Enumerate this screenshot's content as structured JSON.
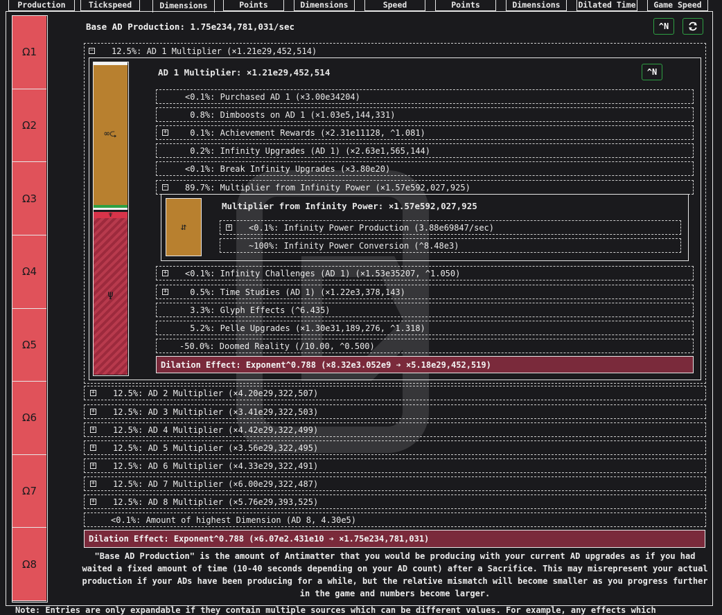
{
  "tabs": [
    {
      "label": "Production"
    },
    {
      "label": "Tickspeed"
    },
    {
      "label": "Dimensions",
      "active": true
    },
    {
      "label": "Points"
    },
    {
      "label": "Dimensions"
    },
    {
      "label": "Speed"
    },
    {
      "label": "Points"
    },
    {
      "label": "Dimensions"
    },
    {
      "label": "Dilated Time"
    },
    {
      "label": "Game Speed"
    }
  ],
  "sidebar": {
    "items": [
      {
        "label": "Ω1"
      },
      {
        "label": "Ω2"
      },
      {
        "label": "Ω3"
      },
      {
        "label": "Ω4"
      },
      {
        "label": "Ω5"
      },
      {
        "label": "Ω6"
      },
      {
        "label": "Ω7"
      },
      {
        "label": "Ω8"
      }
    ]
  },
  "header": {
    "title": "Base AD Production: 1.75e234,781,031/sec",
    "btn_n": "^N",
    "btn_refresh_icon": "refresh-icon"
  },
  "ad1": {
    "row_label": "12.5%: AD 1 Multiplier (×1.21e29,452,514)",
    "title": "AD 1 Multiplier: ×1.21e29,452,514",
    "btn_n": "^N",
    "bar_icons": {
      "top": "∞⮎",
      "bottom": "Ψ"
    },
    "rows": [
      {
        "text": "<0.1%: Purchased AD 1 (×3.00e34204)",
        "expander": false
      },
      {
        "text": " 0.8%: Dimboosts on AD 1 (×1.03e5,144,331)",
        "expander": false
      },
      {
        "text": " 0.1%: Achievement Rewards (×2.31e11128, ^1.081)",
        "expander": true
      },
      {
        "text": " 0.2%: Infinity Upgrades (AD 1) (×2.63e1,565,144)",
        "expander": false
      },
      {
        "text": "<0.1%: Break Infinity Upgrades (×3.80e20)",
        "expander": false
      },
      {
        "text": "89.7%: Multiplier from Infinity Power (×1.57e592,027,925)",
        "expander": true,
        "open": true
      }
    ],
    "ip": {
      "title": "Multiplier from Infinity Power: ×1.57e592,027,925",
      "icon": "⇵",
      "rows": [
        {
          "text": "<0.1%: Infinity Power Production (3.88e69847/sec)",
          "expander": true
        },
        {
          "text": "~100%: Infinity Power Conversion (^8.48e3)",
          "expander": false
        }
      ]
    },
    "rows_after": [
      {
        "text": "<0.1%: Infinity Challenges (AD 1) (×1.53e35207, ^1.050)",
        "expander": true
      },
      {
        "text": " 0.5%: Time Studies (AD 1) (×1.22e3,378,143)",
        "expander": true
      },
      {
        "text": " 3.3%: Glyph Effects (^6.435)",
        "expander": false
      },
      {
        "text": " 5.2%: Pelle Upgrades (×1.30e31,189,276, ^1.318)",
        "expander": false
      },
      {
        "text": "-50.0%: Doomed Reality (/10.00, ^0.500)",
        "expander": false
      }
    ],
    "dilation": "Dilation Effect: Exponent^0.788 (×8.32e3.052e9 ➔ ×5.18e29,452,519)"
  },
  "ad_rows": [
    {
      "text": "12.5%: AD 2 Multiplier (×4.20e29,322,507)"
    },
    {
      "text": "12.5%: AD 3 Multiplier (×3.41e29,322,503)"
    },
    {
      "text": "12.5%: AD 4 Multiplier (×4.42e29,322,499)"
    },
    {
      "text": "12.5%: AD 5 Multiplier (×3.56e29,322,495)"
    },
    {
      "text": "12.5%: AD 6 Multiplier (×4.33e29,322,491)"
    },
    {
      "text": "12.5%: AD 7 Multiplier (×6.00e29,322,487)"
    },
    {
      "text": "12.5%: AD 8 Multiplier (×5.76e29,393,525)"
    }
  ],
  "highest_dim": "<0.1%: Amount of highest Dimension (AD 8, 4.30e5)",
  "dilation_main": "Dilation Effect: Exponent^0.788 (×6.07e2.431e10 ➔ ×1.75e234,781,031)",
  "note_lines": [
    "\"Base AD Production\" is the amount of Antimatter that you would be producing with your current AD upgrades as if you had",
    "waited a fixed amount of time (10-40 seconds depending on your AD count) after a Sacrifice. This may misrepresent your actual",
    "production if your ADs have been producing for a while, but the relative mismatch will become smaller as you progress further",
    "in the game and numbers become larger."
  ],
  "footer_note": "Note: Entries are only expandable if they contain multiple sources which can be different values. For example, any effects which"
}
